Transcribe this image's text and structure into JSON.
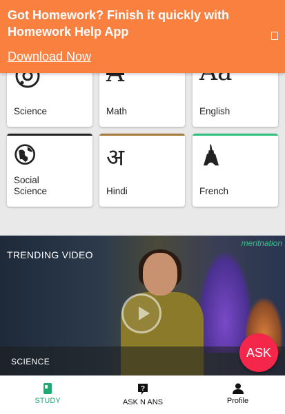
{
  "banner": {
    "title": "Got Homework? Finish it quickly with Homework Help App",
    "link_label": "Download Now",
    "bg_color": "#fa8040"
  },
  "subjects": [
    {
      "label": "Science",
      "icon": "atom-icon",
      "bar": ""
    },
    {
      "label": "Math",
      "icon": "math-a-icon",
      "bar": ""
    },
    {
      "label": "English",
      "icon": "english-aa-icon",
      "bar": ""
    },
    {
      "label": "Social\nScience",
      "icon": "globe-icon",
      "bar": "#222222"
    },
    {
      "label": "Hindi",
      "icon": "hindi-a-icon",
      "bar": "#a3793a"
    },
    {
      "label": "French",
      "icon": "eiffel-tower-icon",
      "bar": "#2ec27e"
    }
  ],
  "glyphs": {
    "math": "A",
    "english": "Aa",
    "hindi": "अ"
  },
  "trending": {
    "title": "TRENDING VIDEO",
    "brand": "meritnation",
    "subject": "SCIENCE"
  },
  "fab": {
    "label": "ASK",
    "color": "#f4264a"
  },
  "nav": {
    "items": [
      {
        "label": "STUDY",
        "icon": "book-icon",
        "active": true,
        "color": "#1faa72"
      },
      {
        "label": "ASK N ANS",
        "icon": "question-icon",
        "active": false
      },
      {
        "label": "Profile",
        "icon": "person-icon",
        "active": false
      }
    ]
  }
}
